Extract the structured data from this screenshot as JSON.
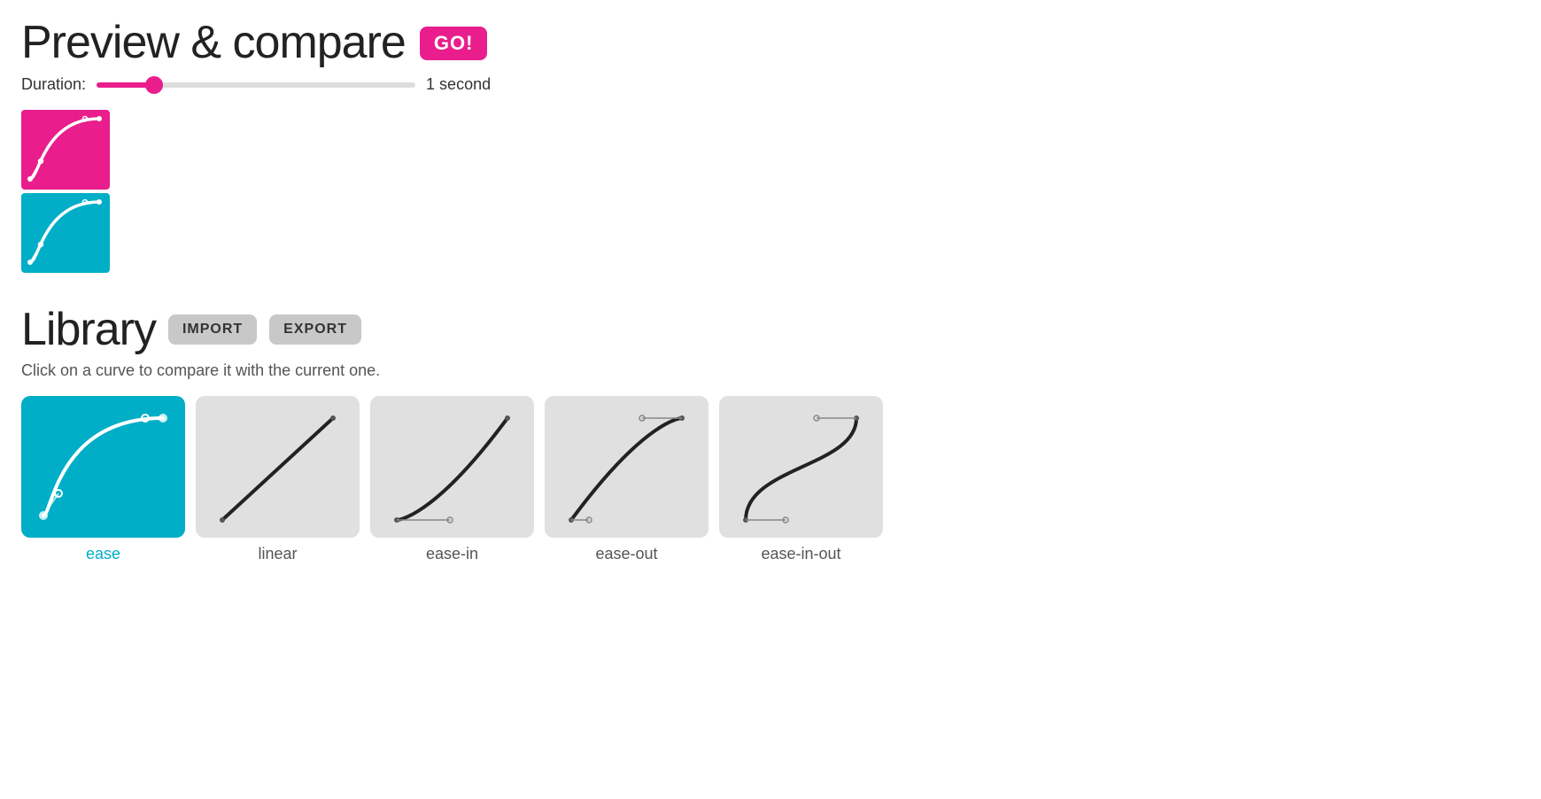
{
  "header": {
    "title": "Preview & compare",
    "go_button": "GO!",
    "duration_label": "Duration:",
    "duration_value": "1 second",
    "duration_min": 0,
    "duration_max": 10,
    "duration_current": 1
  },
  "library": {
    "title": "Library",
    "import_label": "IMPORT",
    "export_label": "EXPORT",
    "hint": "Click on a curve to compare it with the current one.",
    "curves": [
      {
        "id": "ease",
        "label": "ease",
        "active": true
      },
      {
        "id": "linear",
        "label": "linear",
        "active": false
      },
      {
        "id": "ease-in",
        "label": "ease-in",
        "active": false
      },
      {
        "id": "ease-out",
        "label": "ease-out",
        "active": false
      },
      {
        "id": "ease-in-out",
        "label": "ease-in-out",
        "active": false
      }
    ]
  },
  "colors": {
    "accent_pink": "#e91e8c",
    "accent_teal": "#00aec7",
    "inactive_bg": "#e0e0e0",
    "inactive_label": "#555"
  }
}
